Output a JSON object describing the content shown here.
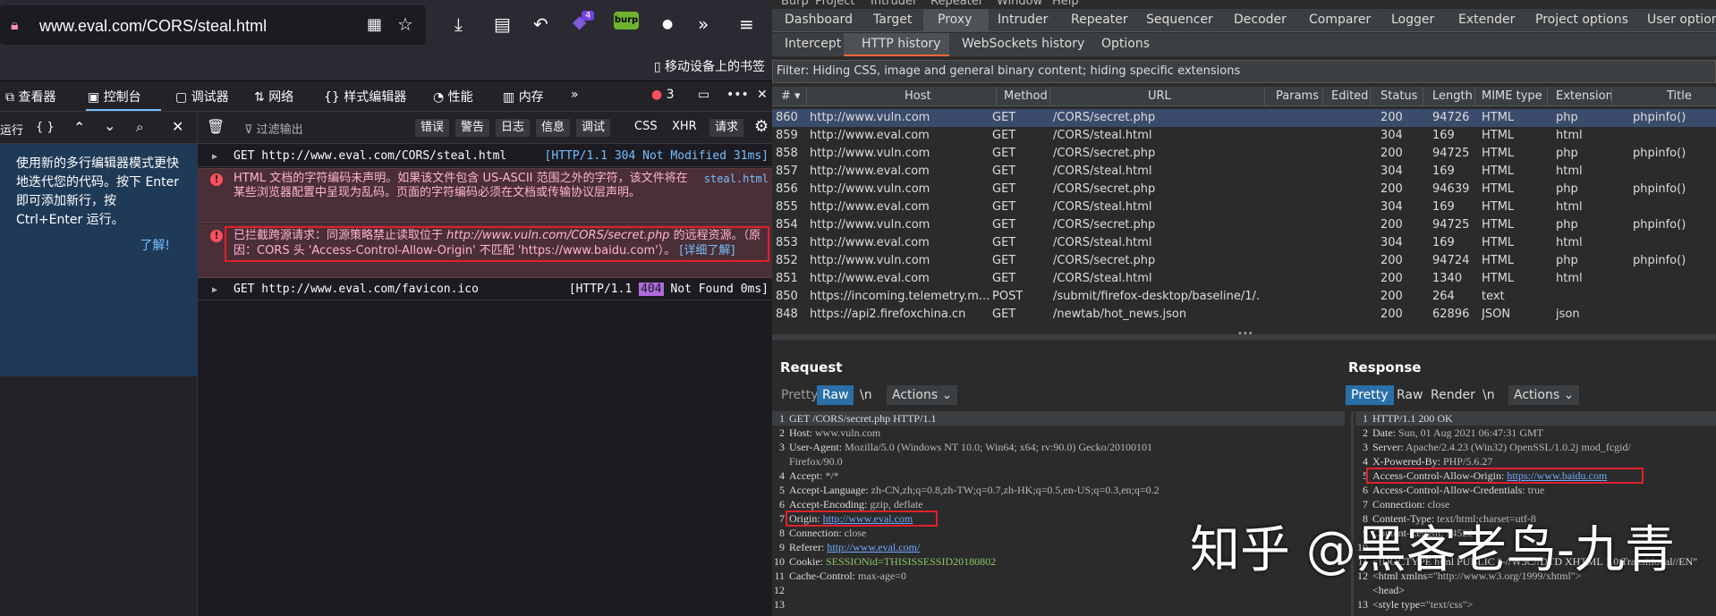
{
  "browser": {
    "url": "www.eval.com/CORS/steal.html",
    "bookmark_label": "移动设备上的书签",
    "ext_badge": "4"
  },
  "devtools": {
    "tabs": [
      "查看器",
      "控制台",
      "调试器",
      "网络",
      "样式编辑器",
      "性能",
      "内存"
    ],
    "error_count": "3",
    "run_label": "运行",
    "braces_label": "{ }",
    "filter_placeholder": "过滤输出",
    "filter_buttons": [
      "错误",
      "警告",
      "日志",
      "信息",
      "调试"
    ],
    "css_label": "CSS",
    "xhr_label": "XHR",
    "requests_label": "请求",
    "editor_hint": "使用新的多行编辑器模式更快地迭代您的代码。按下 Enter 即可添加新行，按 Ctrl+Enter 运行。",
    "editor_hint_link": "了解!",
    "messages": [
      {
        "type": "log",
        "text": "GET http://www.eval.com/CORS/steal.html",
        "right": "[HTTP/1.1  304  Not Modified 31ms]"
      },
      {
        "type": "error",
        "text": "HTML 文档的字符编码未声明。如果该文件包含 US-ASCII 范围之外的字符，该文件将在某些浏览器配置中呈现为乱码。页面的字符编码必须在文档或传输协议层声明。",
        "right": "steal.html"
      },
      {
        "type": "error",
        "text_a": "已拦截跨源请求：同源策略禁止读取位于 ",
        "text_url": "http://www.vuln.com/CORS/secret.php",
        "text_b": " 的远程资源。（原因：CORS 头 'Access-Control-Allow-Origin' 不匹配 'https://www.baidu.com'）。",
        "link": "[详细了解]"
      },
      {
        "type": "log",
        "text": "GET http://www.eval.com/favicon.ico",
        "right_a": "[HTTP/1.1",
        "badge": "404",
        "right_b": "Not Found 0ms]"
      }
    ]
  },
  "burp": {
    "menu": [
      "Burp",
      "Project",
      "Intruder",
      "Repeater",
      "Window",
      "Help"
    ],
    "tabs": [
      "Dashboard",
      "Target",
      "Proxy",
      "Intruder",
      "Repeater",
      "Sequencer",
      "Decoder",
      "Comparer",
      "Logger",
      "Extender",
      "Project options",
      "User options"
    ],
    "subtabs": [
      "Intercept",
      "HTTP history",
      "WebSockets history",
      "Options"
    ],
    "filter": "Filter: Hiding CSS, image and general binary content;  hiding specific extensions",
    "columns": [
      "#",
      "Host",
      "Method",
      "URL",
      "Params",
      "Edited",
      "Status",
      "Length",
      "MIME type",
      "Extension",
      "Title"
    ],
    "rows": [
      {
        "n": "860",
        "host": "http://www.vuln.com",
        "method": "GET",
        "url": "/CORS/secret.php",
        "status": "200",
        "length": "94726",
        "mime": "HTML",
        "ext": "php",
        "title": "phpinfo()"
      },
      {
        "n": "859",
        "host": "http://www.eval.com",
        "method": "GET",
        "url": "/CORS/steal.html",
        "status": "304",
        "length": "169",
        "mime": "HTML",
        "ext": "html",
        "title": ""
      },
      {
        "n": "858",
        "host": "http://www.vuln.com",
        "method": "GET",
        "url": "/CORS/secret.php",
        "status": "200",
        "length": "94725",
        "mime": "HTML",
        "ext": "php",
        "title": "phpinfo()"
      },
      {
        "n": "857",
        "host": "http://www.eval.com",
        "method": "GET",
        "url": "/CORS/steal.html",
        "status": "304",
        "length": "169",
        "mime": "HTML",
        "ext": "html",
        "title": ""
      },
      {
        "n": "856",
        "host": "http://www.vuln.com",
        "method": "GET",
        "url": "/CORS/secret.php",
        "status": "200",
        "length": "94639",
        "mime": "HTML",
        "ext": "php",
        "title": "phpinfo()"
      },
      {
        "n": "855",
        "host": "http://www.eval.com",
        "method": "GET",
        "url": "/CORS/steal.html",
        "status": "304",
        "length": "169",
        "mime": "HTML",
        "ext": "html",
        "title": ""
      },
      {
        "n": "854",
        "host": "http://www.vuln.com",
        "method": "GET",
        "url": "/CORS/secret.php",
        "status": "200",
        "length": "94725",
        "mime": "HTML",
        "ext": "php",
        "title": "phpinfo()"
      },
      {
        "n": "853",
        "host": "http://www.eval.com",
        "method": "GET",
        "url": "/CORS/steal.html",
        "status": "304",
        "length": "169",
        "mime": "HTML",
        "ext": "html",
        "title": ""
      },
      {
        "n": "852",
        "host": "http://www.vuln.com",
        "method": "GET",
        "url": "/CORS/secret.php",
        "status": "200",
        "length": "94724",
        "mime": "HTML",
        "ext": "php",
        "title": "phpinfo()"
      },
      {
        "n": "851",
        "host": "http://www.eval.com",
        "method": "GET",
        "url": "/CORS/steal.html",
        "status": "200",
        "length": "1340",
        "mime": "HTML",
        "ext": "html",
        "title": ""
      },
      {
        "n": "850",
        "host": "https://incoming.telemetry.m...",
        "method": "POST",
        "url": "/submit/firefox-desktop/baseline/1/...",
        "status": "200",
        "length": "264",
        "mime": "text",
        "ext": "",
        "title": ""
      },
      {
        "n": "848",
        "host": "https://api2.firefoxchina.cn",
        "method": "GET",
        "url": "/newtab/hot_news.json",
        "status": "200",
        "length": "62896",
        "mime": "JSON",
        "ext": "json",
        "title": ""
      }
    ],
    "request": {
      "title": "Request",
      "tabs": [
        "Pretty",
        "Raw",
        "\\n",
        "Actions"
      ],
      "lines": [
        {
          "n": "1",
          "k": "GET /CORS/secret.php HTTP/1.1",
          "v": ""
        },
        {
          "n": "2",
          "k": "Host: ",
          "v": "www.vuln.com"
        },
        {
          "n": "3",
          "k": "User-Agent: ",
          "v": "Mozilla/5.0 (Windows NT 10.0; Win64; x64; rv:90.0) Gecko/20100101"
        },
        {
          "n": "",
          "k": "",
          "v": "Firefox/90.0"
        },
        {
          "n": "4",
          "k": "Accept: ",
          "v": "*/*"
        },
        {
          "n": "5",
          "k": "Accept-Language: ",
          "v": "zh-CN,zh;q=0.8,zh-TW;q=0.7,zh-HK;q=0.5,en-US;q=0.3,en;q=0.2"
        },
        {
          "n": "6",
          "k": "Accept-Encoding: ",
          "v": "gzip, deflate"
        },
        {
          "n": "7",
          "k": "Origin: ",
          "v": "http://www.eval.com"
        },
        {
          "n": "8",
          "k": "Connection: ",
          "v": "close"
        },
        {
          "n": "9",
          "k": "Referer: ",
          "v": "http://www.eval.com/"
        },
        {
          "n": "10",
          "k": "Cookie: ",
          "v": "SESSIONid=THISISSESSID20180802"
        },
        {
          "n": "11",
          "k": "Cache-Control: ",
          "v": "max-age=0"
        },
        {
          "n": "12",
          "k": "",
          "v": ""
        },
        {
          "n": "13",
          "k": "",
          "v": ""
        }
      ]
    },
    "response": {
      "title": "Response",
      "tabs": [
        "Pretty",
        "Raw",
        "Render",
        "\\n",
        "Actions"
      ],
      "lines": [
        {
          "n": "1",
          "k": "HTTP/1.1 200 OK",
          "v": ""
        },
        {
          "n": "2",
          "k": "Date: ",
          "v": "Sun, 01 Aug 2021 06:47:31 GMT"
        },
        {
          "n": "3",
          "k": "Server: ",
          "v": "Apache/2.4.23 (Win32) OpenSSL/1.0.2j mod_fcgid/"
        },
        {
          "n": "4",
          "k": "X-Powered-By: ",
          "v": "PHP/5.6.27"
        },
        {
          "n": "5",
          "k": "Access-Control-Allow-Origin: ",
          "v": "https://www.baidu.com"
        },
        {
          "n": "6",
          "k": "Access-Control-Allow-Credentials: ",
          "v": "true"
        },
        {
          "n": "7",
          "k": "Connection: ",
          "v": "close"
        },
        {
          "n": "8",
          "k": "Content-Type: ",
          "v": "text/html;charset=utf-8"
        },
        {
          "n": "9",
          "k": "Content-Length: ",
          "v": "94522"
        },
        {
          "n": "10",
          "k": "",
          "v": ""
        },
        {
          "n": "11",
          "k": "<!DOCTYPE html PUBLIC \"-//W3C//DTD XHTML 1.0 Transitional//EN\"",
          "v": ""
        },
        {
          "n": "12",
          "k": "<html xmlns=",
          "v": "\"http://www.w3.org/1999/xhtml\">"
        },
        {
          "n": "",
          "k": "  <head>",
          "v": ""
        },
        {
          "n": "13",
          "k": "    <style type=",
          "v": "\"text/css\">"
        }
      ]
    }
  },
  "watermark": "知乎 @黑客老鸟-九青"
}
